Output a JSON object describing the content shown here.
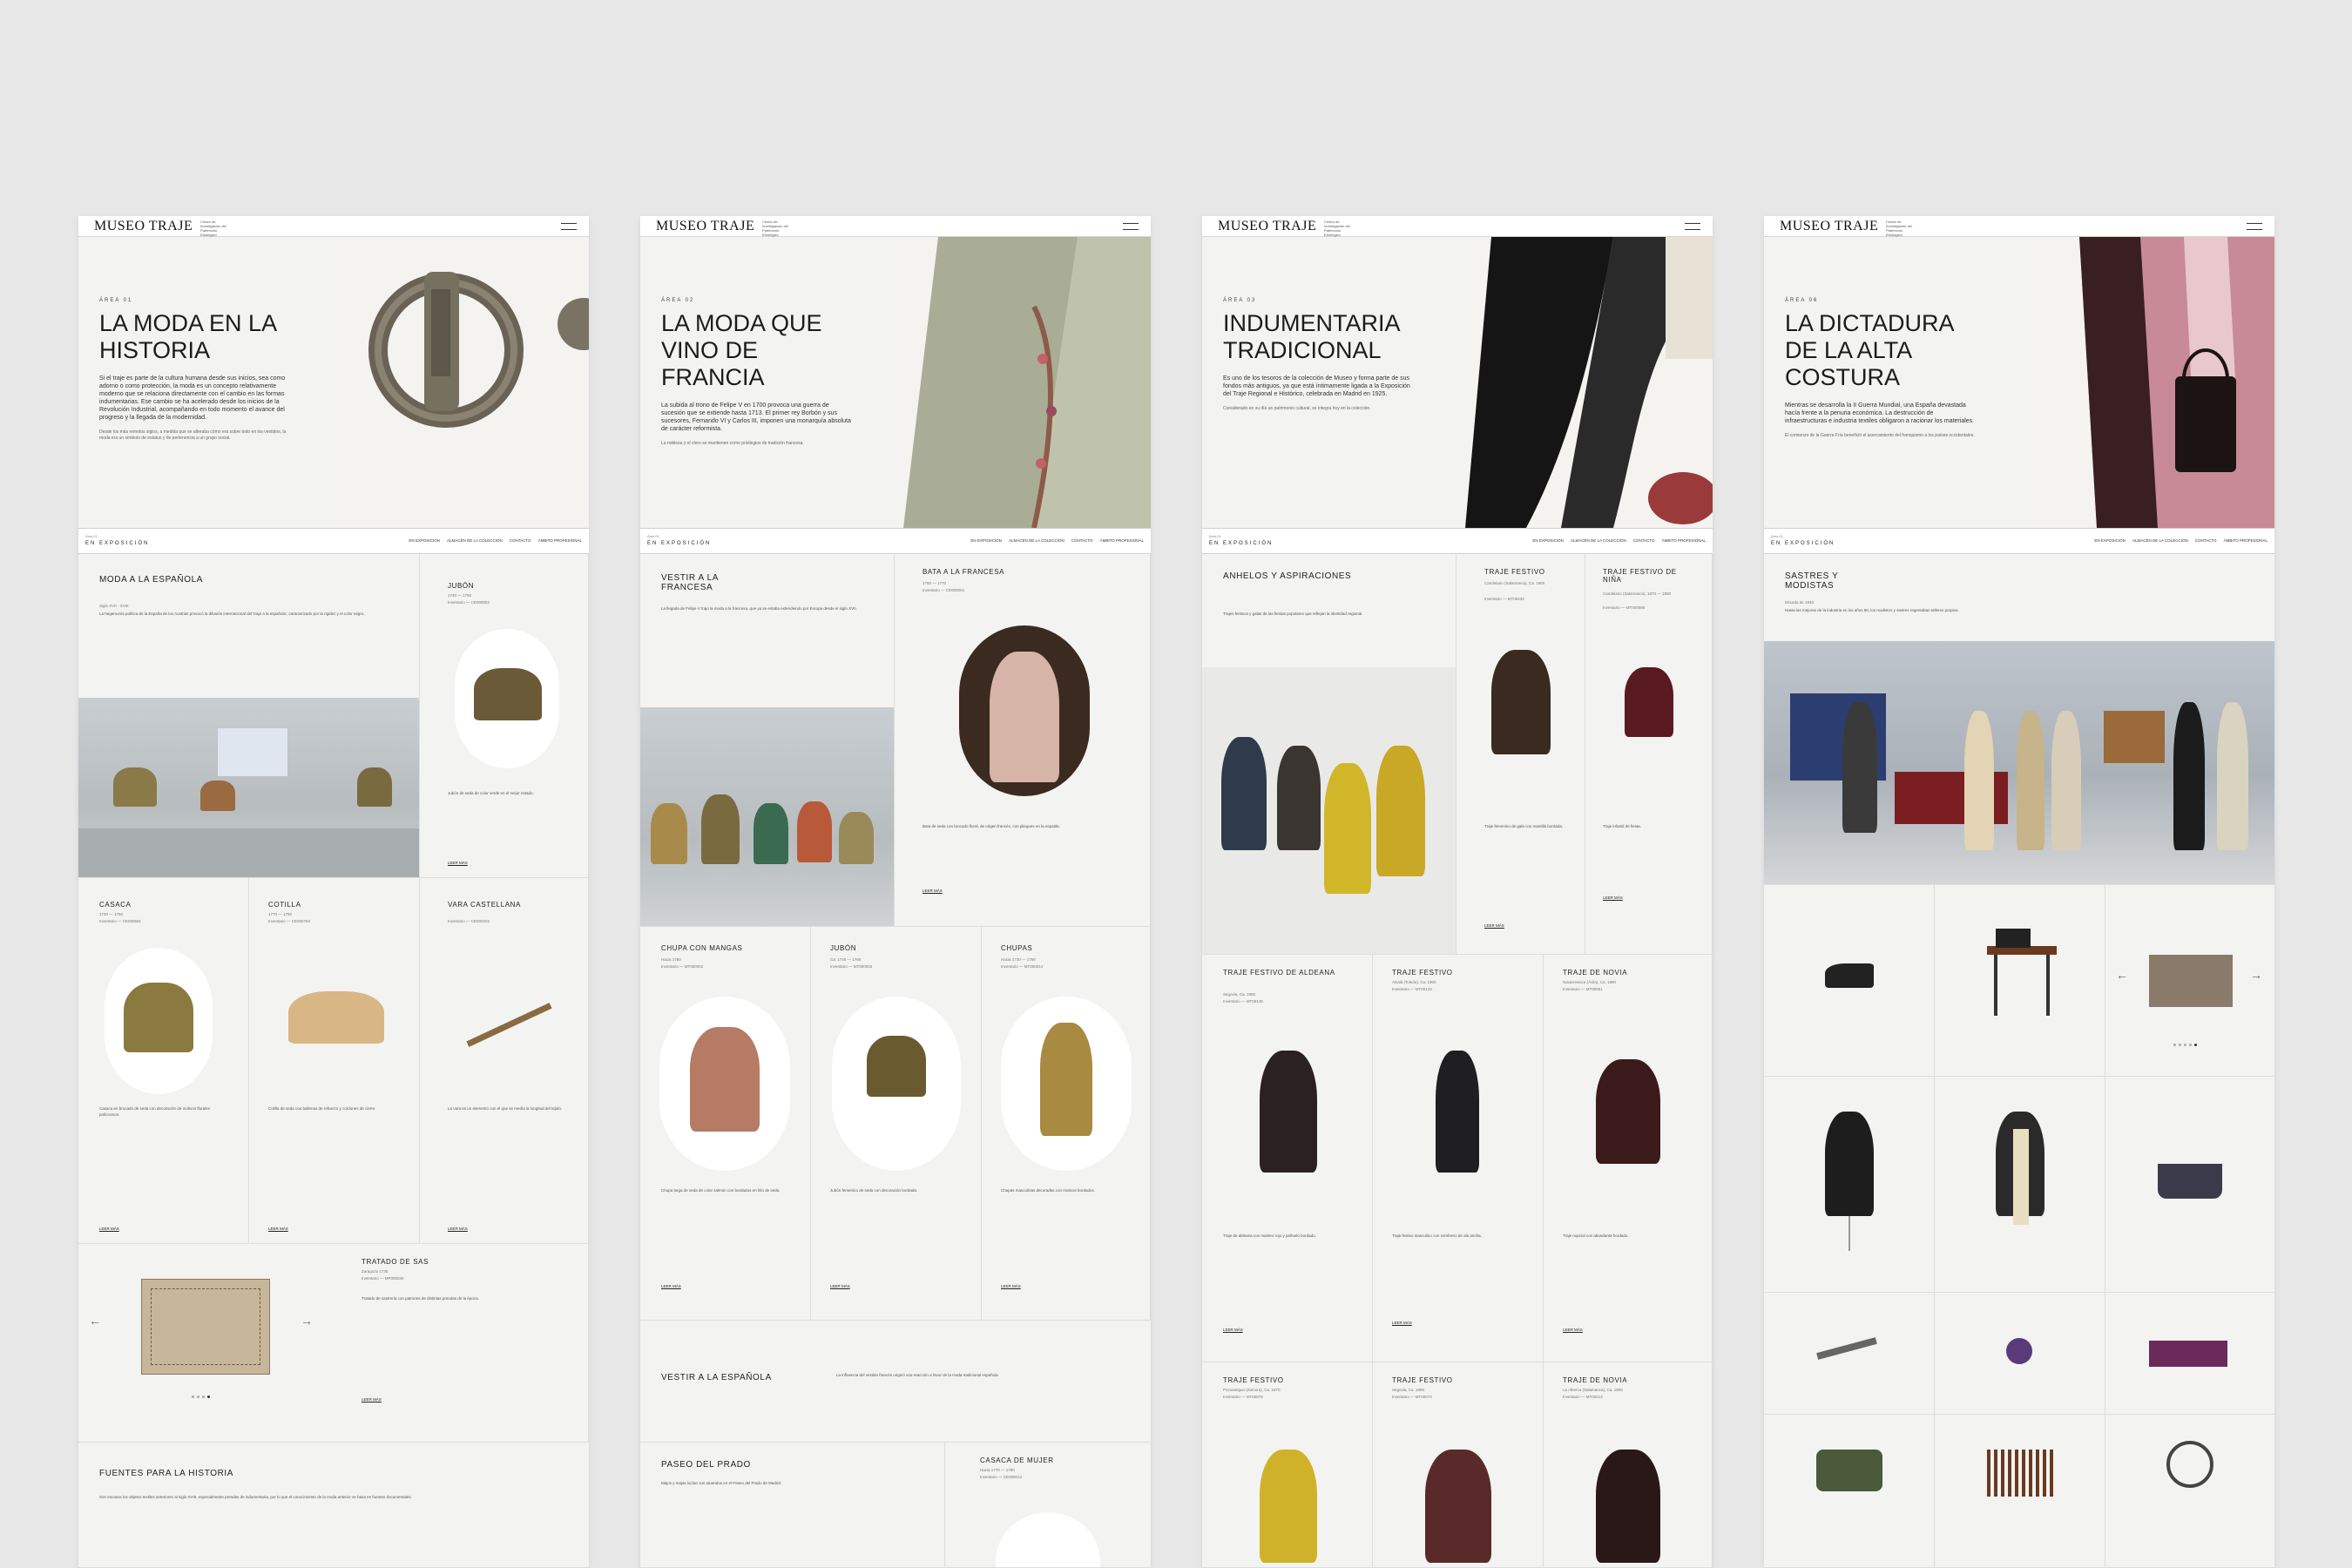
{
  "brand": {
    "logo": "MUSEO TRAJE",
    "logo_sub": "Centro de Investigación del Patrimonio Etnológico"
  },
  "subnav": {
    "kicker": "Área 01",
    "title": "EN EXPOSICIÓN",
    "links": [
      "EN EXPOSICIÓN",
      "ALMACÉN DE LA COLECCIÓN",
      "CONTACTO",
      "ÁMBITO PROFESIONAL"
    ]
  },
  "panels": [
    {
      "kicker": "ÁREA 01",
      "title": "LA MODA EN LA HISTORIA",
      "lead": "Si el traje es parte de la cultura humana desde sus inicios, sea como adorno o como protección, la moda es un concepto relativamente moderno que se relaciona directamente con el cambio en las formas indumentarias. Ese cambio se ha acelerado desde los inicios de la Revolución Industrial, acompañando en todo momento el avance del progreso y la llegada de la modernidad.",
      "body": "Desde los más remotos siglos, a medida que se alteraba cómo era sobre todo en los vestidos, la moda era un símbolo de estatus y de pertenencia a un grupo social.",
      "s1": {
        "title": "MODA A LA ESPAÑOLA",
        "date": "Siglo XVII - XVIII",
        "text": "La hegemonía política de la España de los Austrias provocó la difusión internacional del 'traje a la española', caracterizado por la rigidez y el color negro."
      },
      "jubon": {
        "title": "JUBÓN",
        "date": "1740 — 1760",
        "inv": "Inventario — CE000052",
        "text": "Jubón de seda de color verde en el mejor estado.",
        "more": "LEER MÁS"
      },
      "casaca": {
        "title": "CASACA",
        "date": "1740 — 1760",
        "inv": "Inventario — CE000561",
        "text": "Casaca en brocado de seda con decoración de motivos florales polícromos.",
        "more": "LEER MÁS"
      },
      "cotilla": {
        "title": "COTILLA",
        "date": "1770 — 1780",
        "inv": "Inventario — CE000794",
        "text": "Cotilla de seda con ballenas de refuerzo y cordones de cierre.",
        "more": "LEER MÁS"
      },
      "vara": {
        "title": "VARA CASTELLANA",
        "date": "",
        "inv": "Inventario — CE000203",
        "text": "La vara es un elemento con el que se medía la longitud del tejido.",
        "more": "LEER MÁS"
      },
      "tratado": {
        "title": "TRATADO DE SAS",
        "date": "Zaragoza 1730",
        "inv": "Inventario — MP000025",
        "text": "Tratado de sastrería con patrones de distintas prendas de la época.",
        "more": "LEER MÁS"
      },
      "fuentes": {
        "title": "FUENTES PARA LA HISTORIA",
        "text": "Son escasos los objetos textiles anteriores al siglo XVIII, especialmente prendas de indumentaria, por lo que el conocimiento de la moda anterior se basa en fuentes documentales."
      }
    },
    {
      "kicker": "ÁREA 02",
      "title": "LA MODA QUE VINO DE FRANCIA",
      "lead": "La subida al trono de Felipe V en 1700 provoca una guerra de sucesión que se extiende hasta 1713. El primer rey Borbón y sus sucesores, Fernando VI y Carlos III, imponen una monarquía absoluta de carácter reformista.",
      "body": "La nobleza y el clero se mantienen como privilegios de tradición francesa.",
      "s1": {
        "title": "VESTIR A LA FRANCESA",
        "text": "La llegada de Felipe V trajo la moda a la francesa, que ya se estaba extendiendo por Europa desde el siglo XVII."
      },
      "bata": {
        "title": "BATA A LA FRANCESA",
        "date": "1760 — 1770",
        "inv": "Inventario — CE000004",
        "text": "Bata de seda con brocado floral, de origen francés, con pliegues en la espalda.",
        "more": "LEER MÁS"
      },
      "chupa_m": {
        "title": "CHUPA CON MANGAS",
        "date": "Hacia 1780",
        "inv": "Inventario — MT000002",
        "text": "Chupa larga de seda de color salmón con bordados en hilo de seda.",
        "more": "LEER MÁS"
      },
      "jubon": {
        "title": "JUBÓN",
        "date": "Ca. 1740 — 1760",
        "inv": "Inventario — MT000002",
        "text": "Jubón femenino de seda con decoración bordada.",
        "more": "LEER MÁS"
      },
      "chupas": {
        "title": "CHUPAS",
        "date": "Hacia 1730 — 1750",
        "inv": "Inventario — MT000014",
        "text": "Chupas masculinas decoradas con motivos bordados.",
        "more": "LEER MÁS"
      },
      "s2": {
        "title": "VESTIR A LA ESPAÑOLA",
        "text": "La influencia del vestido francés originó una reacción a favor de la moda tradicional española."
      },
      "prado": {
        "title": "PASEO DEL PRADO",
        "text": "Majos y majas lucían sus atuendos en el Paseo del Prado de Madrid."
      },
      "casaca": {
        "title": "CASACA DE MUJER",
        "date": "Hacia 1770 — 1780",
        "inv": "Inventario — CE000012"
      }
    },
    {
      "kicker": "ÁREA 03",
      "title": "INDUMENTARIA TRADICIONAL",
      "lead": "Es uno de los tesoros de la colección de Museo y forma parte de sus fondos más antiguos, ya que está íntimamente ligada a la Exposición del Traje Regional e Histórico, celebrada en Madrid en 1925.",
      "body": "Considerado en su día un patrimonio cultural, se integra hoy en la colección.",
      "s1": {
        "title": "ANHELOS Y ASPIRACIONES",
        "text": "Trajes festivos y galas de las fiestas populares que reflejan la identidad regional."
      },
      "tf": {
        "title": "TRAJE FESTIVO",
        "date": "Candelario (Salamanca), Ca. 1900",
        "inv": "Inventario — MT00234",
        "text": "Traje femenino de gala con mantilla bordada.",
        "more": "LEER MÁS"
      },
      "tn": {
        "title": "TRAJE FESTIVO DE NIÑA",
        "date": "Candelario (Salamanca), 1870 — 1900",
        "inv": "Inventario — MT000086",
        "text": "Traje infantil de fiesta.",
        "more": "LEER MÁS"
      },
      "alcena": {
        "title": "TRAJE FESTIVO DE ALDEANA",
        "date": "Segovia, Ca. 1900",
        "inv": "Inventario — MT00145",
        "text": "Traje de aldeana con manteo rojo y pañuelo bordado.",
        "more": "LEER MÁS"
      },
      "tf2": {
        "title": "TRAJE FESTIVO",
        "date": "Alcalá (Toledo), Ca. 1900",
        "inv": "Inventario — MT00123",
        "text": "Traje festivo masculino con sombrero de ala ancha.",
        "more": "LEER MÁS"
      },
      "novia": {
        "title": "TRAJE DE NOVIA",
        "date": "Navarrevisca (Ávila), Ca. 1890",
        "inv": "Inventario — MT00061",
        "text": "Traje nupcial con abundante bordado.",
        "more": "LEER MÁS"
      },
      "tf3": {
        "title": "TRAJE FESTIVO",
        "date": "Pozoantiguo (Zamora), Ca. 1870",
        "inv": "Inventario — MT00078"
      },
      "tf4": {
        "title": "TRAJE FESTIVO",
        "date": "Segovia, Ca. 1900",
        "inv": "Inventario — MT00074"
      },
      "novia2": {
        "title": "TRAJE DE NOVIA",
        "date": "La Alberca (Salamanca), Ca. 1900",
        "inv": "Inventario — MT00212"
      }
    },
    {
      "kicker": "ÁREA 06",
      "title": "LA DICTADURA DE LA ALTA COSTURA",
      "lead": "Mientras se desarrolla la II Guerra Mundial, una España devastada hacía frente a la penuria económica. La destrucción de infraestructuras e industria textiles obligaron a racionar los materiales.",
      "body": "El comienzo de la Guerra Fría benefició el acercamiento del franquismo a los países occidentales.",
      "s1": {
        "title": "SASTRES Y MODISTAS",
        "date": "Década de 1940",
        "text": "Hasta las mejoras de la industria en los años 60, los modistos y sastres regentaban talleres propios."
      }
    }
  ]
}
